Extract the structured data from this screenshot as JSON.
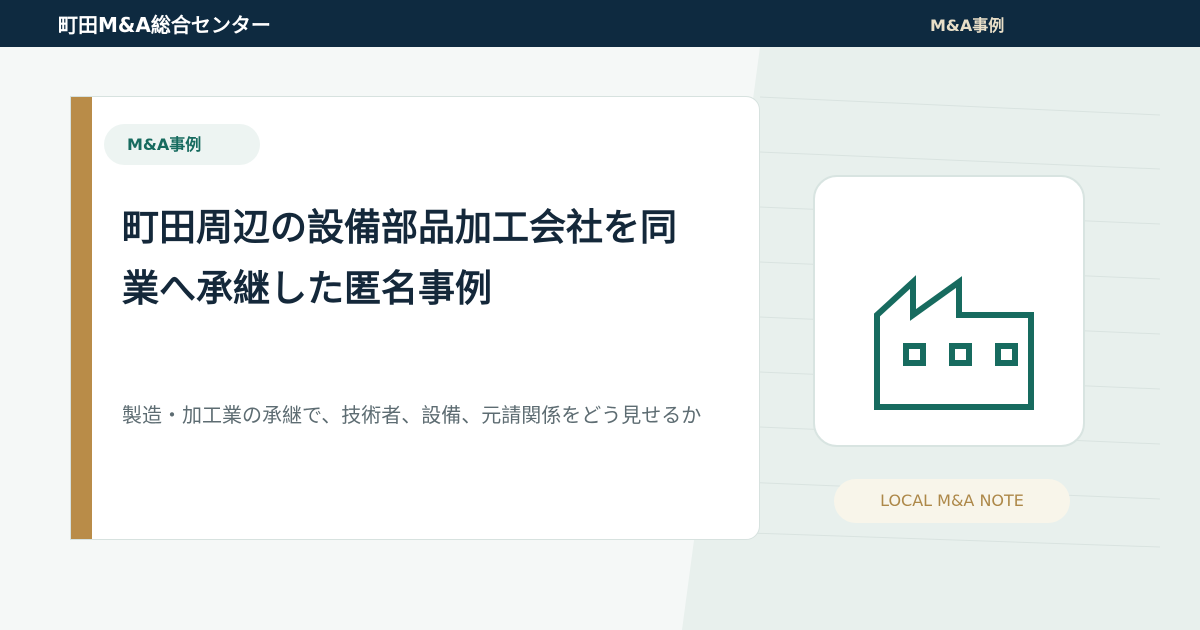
{
  "header": {
    "brand": "町田M&A総合センター",
    "nav_label": "M&A事例"
  },
  "article": {
    "category": "M&A事例",
    "title": "町田周辺の設備部品加工会社を同業へ承継した匿名事例",
    "subtitle": "製造・加工業の承継で、技術者、設備、元請関係をどう見せるか"
  },
  "aside": {
    "icon": "factory-icon",
    "note_label": "LOCAL M&A NOTE"
  },
  "colors": {
    "header_bg": "#0e2a40",
    "accent_gold": "#b98c48",
    "accent_teal": "#176b5f",
    "title_text": "#14283a"
  }
}
